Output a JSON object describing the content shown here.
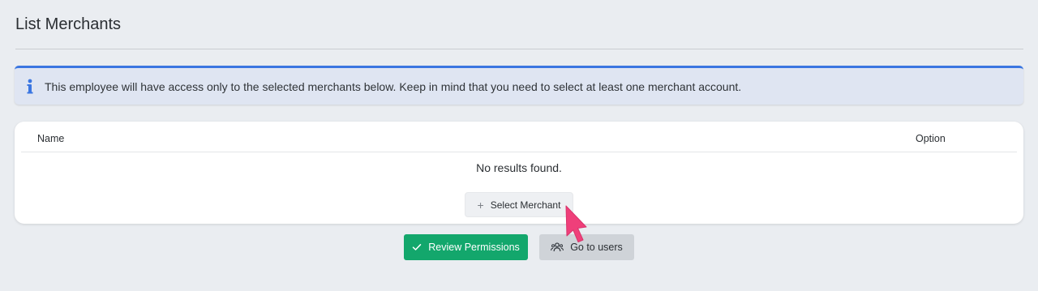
{
  "page": {
    "title": "List Merchants"
  },
  "alert": {
    "icon": "info-icon",
    "message": "This employee will have access only to the selected merchants below. Keep in mind that you need to select at least one merchant account.",
    "accent_color": "#3b76e1"
  },
  "table": {
    "columns": [
      "Name",
      "Option"
    ],
    "rows": [],
    "empty_message": "No results found."
  },
  "actions": {
    "select_merchant_label": "Select Merchant",
    "review_permissions_label": "Review Permissions",
    "go_to_users_label": "Go to users"
  },
  "colors": {
    "primary_green": "#13a76c",
    "secondary_gray": "#cfd3d8",
    "cursor_pink": "#ef3f7a"
  }
}
